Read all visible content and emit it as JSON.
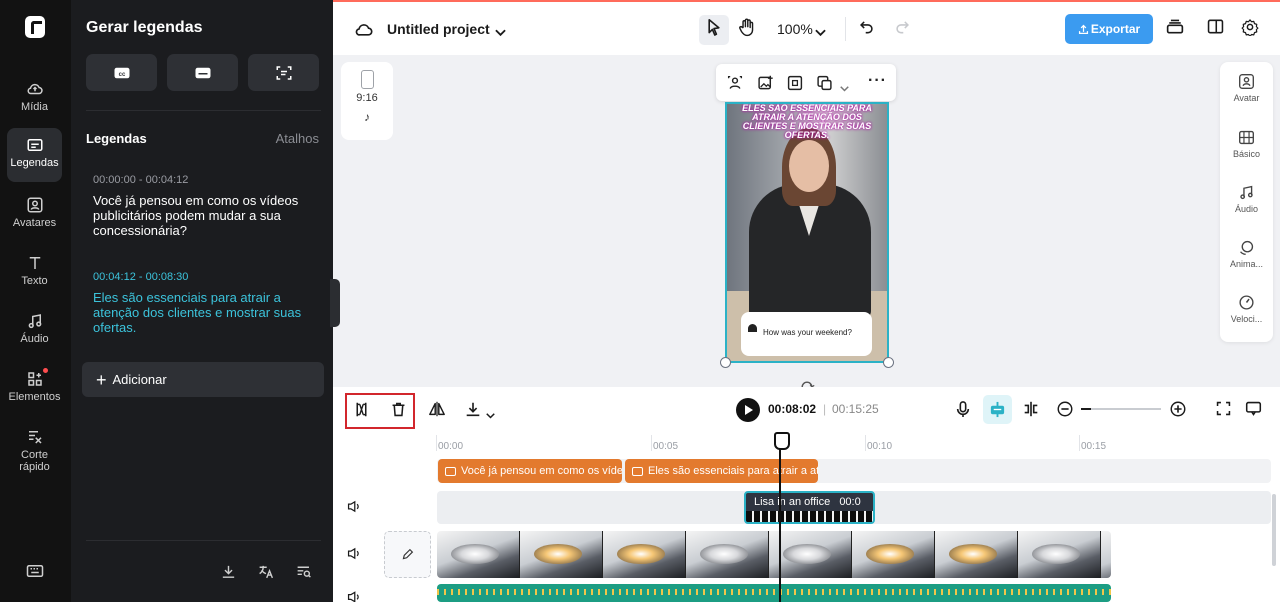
{
  "rail": {
    "items": [
      {
        "label": "Mídia",
        "icon": "cloud-upload-icon"
      },
      {
        "label": "Legendas",
        "icon": "captions-icon"
      },
      {
        "label": "Avatares",
        "icon": "avatar-icon"
      },
      {
        "label": "Texto",
        "icon": "text-icon"
      },
      {
        "label": "Áudio",
        "icon": "music-icon"
      },
      {
        "label": "Elementos",
        "icon": "elements-icon"
      },
      {
        "label": "Corte rápido",
        "icon": "quick-cut-icon"
      }
    ]
  },
  "panel": {
    "title": "Gerar legendas",
    "section_title": "Legendas",
    "shortcuts_label": "Atalhos",
    "captions": [
      {
        "time": "00:00:00 - 00:04:12",
        "text": "Você já pensou em como os vídeos publicitários podem mudar a sua concessionária?"
      },
      {
        "time": "00:04:12 - 00:08:30",
        "text": "Eles são essenciais para atrair a atenção dos clientes e mostrar suas ofertas."
      }
    ],
    "add_label": "Adicionar"
  },
  "topbar": {
    "project_name": "Untitled project",
    "zoom": "100%",
    "export_label": "Exportar"
  },
  "canvas": {
    "ratio_label": "9:16",
    "overlay_text": "ELES SÃO ESSENCIAIS PARA ATRAIR A ATENÇÃO DOS CLIENTES E MOSTRAR SUAS OFERTAS.",
    "chat_text": "How was your weekend?"
  },
  "right_rail": {
    "items": [
      {
        "label": "Avatar"
      },
      {
        "label": "Básico"
      },
      {
        "label": "Áudio"
      },
      {
        "label": "Anima..."
      },
      {
        "label": "Veloci..."
      }
    ]
  },
  "timeline": {
    "current_time": "00:08:02",
    "separator": "|",
    "total_time": "00:15:25",
    "ticks": [
      "00:00",
      "00:05",
      "00:10",
      "00:15"
    ],
    "subtitle_clips": [
      "Você já pensou em como os vídeos publicitários podem mudar a sua concessionária?",
      "Eles são essenciais para atrair a atenção dos clientes e mostrar suas ofertas."
    ],
    "avatar_clip": {
      "title": "Lisa in an office",
      "duration": "00:0"
    }
  },
  "colors": {
    "accent": "#3b9bf0",
    "caption_active": "#3cc3db",
    "subtitle_clip": "#e37a2e",
    "highlight_box": "#d2262c"
  }
}
